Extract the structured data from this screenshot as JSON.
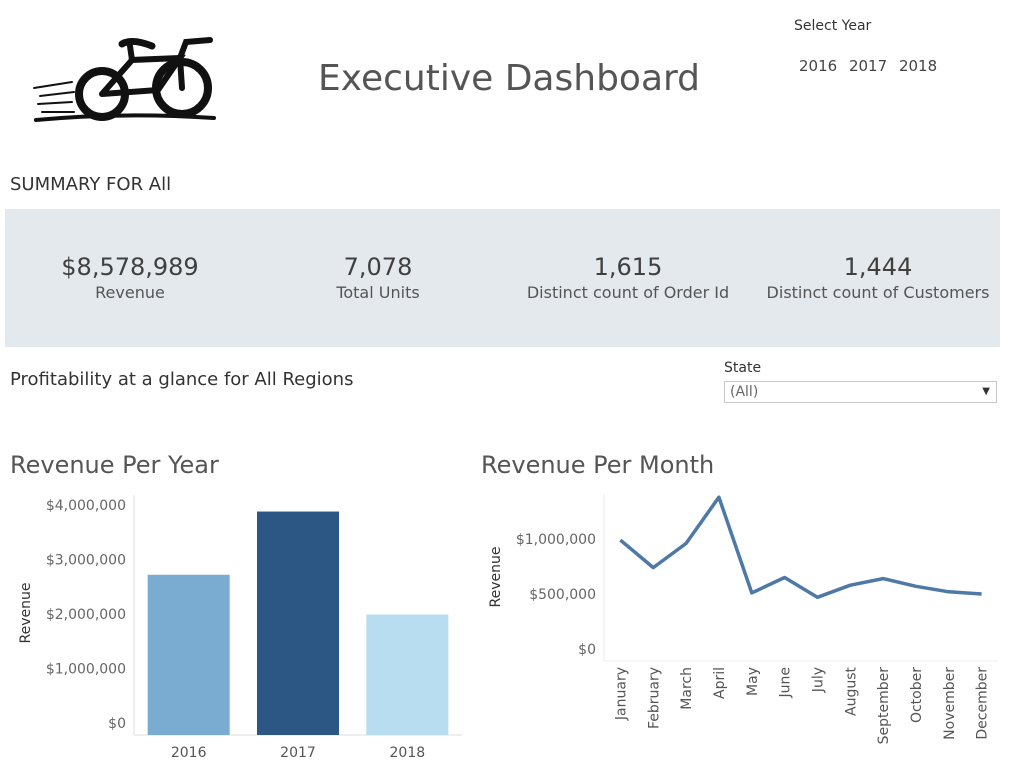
{
  "header": {
    "title": "Executive Dashboard",
    "year_filter": {
      "label": "Select Year",
      "options": [
        "2016",
        "2017",
        "2018"
      ]
    }
  },
  "summary": {
    "title": "SUMMARY FOR All",
    "kpis": [
      {
        "value": "$8,578,989",
        "label": "Revenue"
      },
      {
        "value": "7,078",
        "label": "Total Units"
      },
      {
        "value": "1,615",
        "label": "Distinct count of Order Id"
      },
      {
        "value": "1,444",
        "label": "Distinct count of Customers"
      }
    ]
  },
  "profitability": {
    "title": "Profitability at a glance for All Regions",
    "state_filter": {
      "label": "State",
      "value": "(All)"
    }
  },
  "colors": {
    "bar_2016": "#7aabd0",
    "bar_2017": "#2c5784",
    "bar_2018": "#b9ddf0",
    "line": "#4e79a7",
    "kpi_band": "#e4e9ed"
  },
  "chart_data": [
    {
      "type": "bar",
      "title": "Revenue Per Year",
      "ylabel": "Revenue",
      "categories": [
        "2016",
        "2017",
        "2018"
      ],
      "values": [
        2720000,
        3880000,
        1990000
      ],
      "ylim": [
        0,
        4000000
      ],
      "yticks": [
        0,
        1000000,
        2000000,
        3000000,
        4000000
      ],
      "ytick_labels": [
        "$0",
        "$1,000,000",
        "$2,000,000",
        "$3,000,000",
        "$4,000,000"
      ]
    },
    {
      "type": "line",
      "title": "Revenue Per Month",
      "ylabel": "Revenue",
      "categories": [
        "January",
        "February",
        "March",
        "April",
        "May",
        "June",
        "July",
        "August",
        "September",
        "October",
        "November",
        "December"
      ],
      "values": [
        990000,
        740000,
        960000,
        1380000,
        510000,
        650000,
        470000,
        580000,
        640000,
        570000,
        520000,
        500000
      ],
      "ylim": [
        0,
        1400000
      ],
      "yticks": [
        0,
        500000,
        1000000
      ],
      "ytick_labels": [
        "$0",
        "$500,000",
        "$1,000,000"
      ]
    }
  ]
}
